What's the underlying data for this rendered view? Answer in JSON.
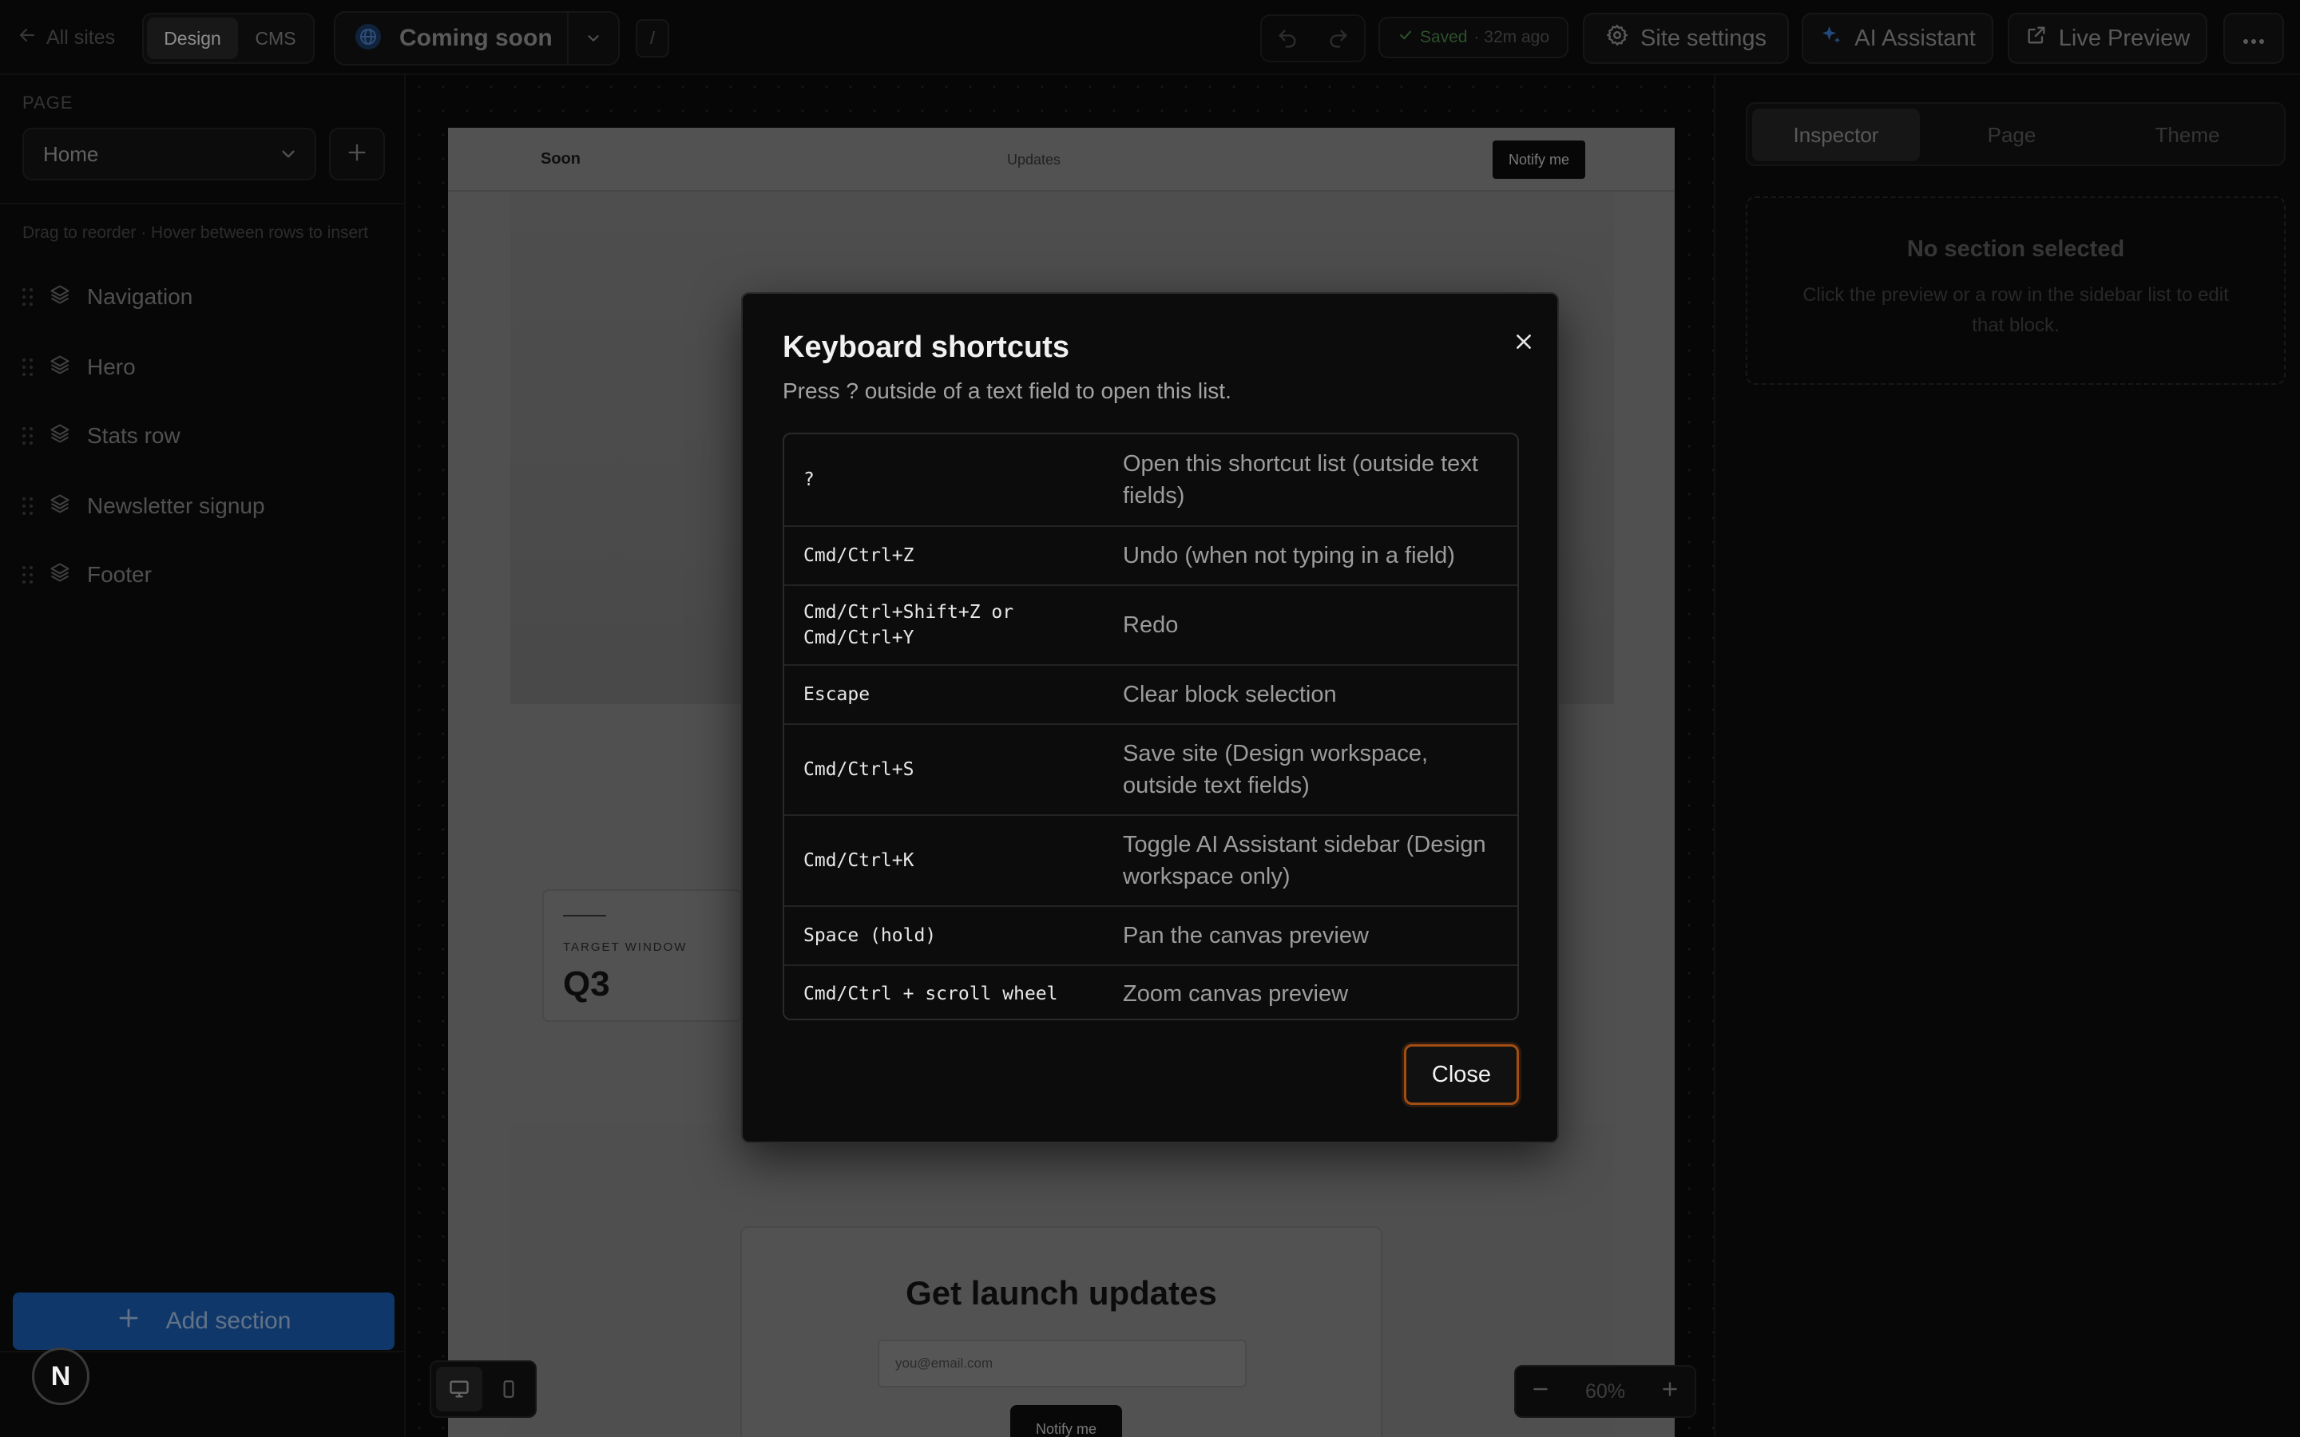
{
  "topbar": {
    "back_label": "All sites",
    "mode_design": "Design",
    "mode_cms": "CMS",
    "site_name": "Coming soon",
    "path": "/",
    "saved_status": "Saved",
    "saved_time": "· 32m ago",
    "site_settings": "Site settings",
    "ai_assistant": "AI Assistant",
    "live_preview": "Live Preview"
  },
  "sidebar": {
    "page_label": "PAGE",
    "page_selected": "Home",
    "hint": "Drag to reorder · Hover between rows to insert",
    "sections": [
      "Navigation",
      "Hero",
      "Stats row",
      "Newsletter signup",
      "Footer"
    ],
    "add_section": "Add section",
    "avatar_letter": "N"
  },
  "preview": {
    "brand": "Soon",
    "nav_link": "Updates",
    "nav_button": "Notify me",
    "stat_label": "TARGET WINDOW",
    "stat_value": "Q3",
    "newsletter_heading": "Get launch updates",
    "email_placeholder": "you@email.com",
    "newsletter_button": "Notify me"
  },
  "zoom": {
    "level": "60%"
  },
  "right_panel": {
    "tabs": [
      "Inspector",
      "Page",
      "Theme"
    ],
    "active_tab": "Inspector",
    "empty_title": "No section selected",
    "empty_desc": "Click the preview or a row in the sidebar list to edit that block."
  },
  "modal": {
    "title": "Keyboard shortcuts",
    "subtitle": "Press ? outside of a text field to open this list.",
    "shortcuts": [
      {
        "key": "?",
        "desc": "Open this shortcut list (outside text fields)"
      },
      {
        "key": "Cmd/Ctrl+Z",
        "desc": "Undo (when not typing in a field)"
      },
      {
        "key": "Cmd/Ctrl+Shift+Z or\nCmd/Ctrl+Y",
        "desc": "Redo"
      },
      {
        "key": "Escape",
        "desc": "Clear block selection"
      },
      {
        "key": "Cmd/Ctrl+S",
        "desc": "Save site (Design workspace, outside text fields)"
      },
      {
        "key": "Cmd/Ctrl+K",
        "desc": "Toggle AI Assistant sidebar (Design workspace only)"
      },
      {
        "key": "Space (hold)",
        "desc": "Pan the canvas preview"
      },
      {
        "key": "Cmd/Ctrl + scroll wheel",
        "desc": "Zoom canvas preview"
      }
    ],
    "close_label": "Close"
  },
  "colors": {
    "accent_blue": "#1c5fb5",
    "saved_green": "#4d8a4d",
    "focus_orange": "#a24e12"
  }
}
